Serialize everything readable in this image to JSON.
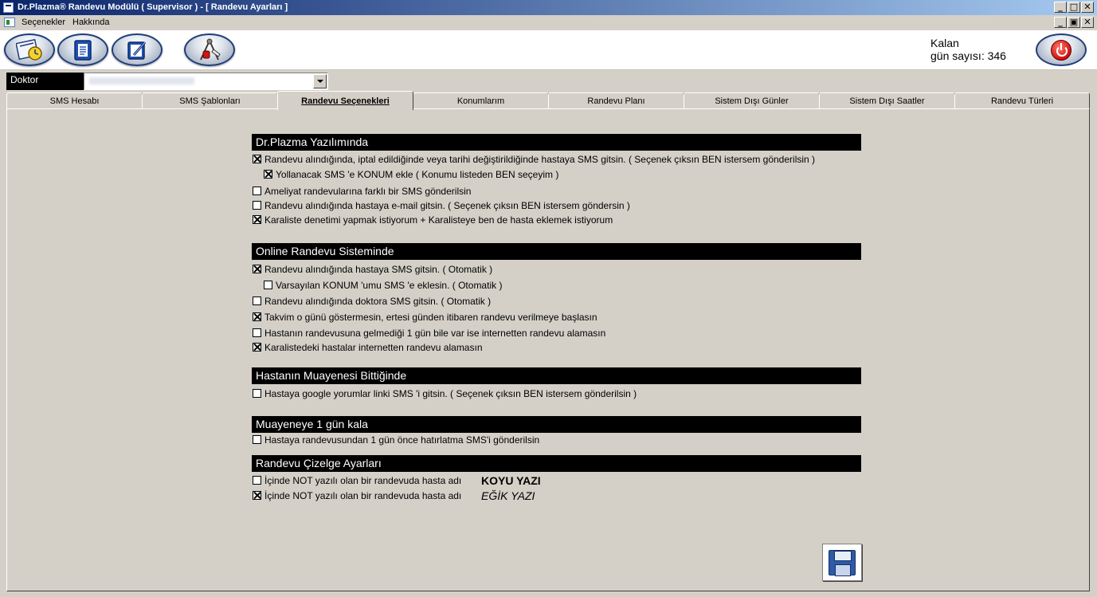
{
  "window": {
    "title": "Dr.Plazma® Randevu Modülü ( Supervisor ) - [ Randevu Ayarları ]",
    "minimize": "_",
    "maximize": "□",
    "restore": "▣",
    "close": "✕"
  },
  "menu": {
    "items": [
      "Seçenekler",
      "Hakkında"
    ]
  },
  "toolbar": {
    "buttons": [
      "calendar-clock-icon",
      "document-icon",
      "edit-icon",
      "tools-icon"
    ],
    "kalan_line1": "Kalan",
    "kalan_line2": "gün sayısı: 346",
    "power_icon": "power-icon"
  },
  "doctor": {
    "label": "Doktor"
  },
  "tabs": [
    {
      "label": "SMS Hesabı"
    },
    {
      "label": "SMS Şablonları"
    },
    {
      "label": "Randevu Seçenekleri",
      "active": true
    },
    {
      "label": "Konumlarım"
    },
    {
      "label": "Randevu Planı"
    },
    {
      "label": "Sistem Dışı Günler"
    },
    {
      "label": "Sistem Dışı Saatler"
    },
    {
      "label": "Randevu Türleri"
    }
  ],
  "sections": [
    {
      "title": "Dr.Plazma Yazılımında",
      "options": [
        {
          "label": "Randevu alındığında, iptal edildiğinde veya tarihi değiştirildiğinde hastaya SMS gitsin. ( Seçenek çıksın BEN istersem gönderilsin )",
          "checked": true
        },
        {
          "label": "Yollanacak SMS 'e  KONUM ekle ( Konumu listeden BEN seçeyim )",
          "checked": true
        },
        {
          "label": "Ameliyat randevularına farklı bir SMS gönderilsin",
          "checked": false
        },
        {
          "label": "Randevu alındığında hastaya e-mail gitsin. ( Seçenek çıksın BEN istersem göndersin )",
          "checked": false
        },
        {
          "label": "Karaliste denetimi yapmak istiyorum + Karalisteye ben de hasta eklemek istiyorum",
          "checked": true
        }
      ]
    },
    {
      "title": "Online Randevu Sisteminde",
      "options": [
        {
          "label": "Randevu alındığında hastaya SMS gitsin. ( Otomatik )",
          "checked": true
        },
        {
          "label": "Varsayılan KONUM 'umu SMS 'e eklesin. ( Otomatik )",
          "checked": false
        },
        {
          "label": "Randevu alındığında doktora SMS gitsin. ( Otomatik )",
          "checked": false
        },
        {
          "label": "Takvim o günü göstermesin, ertesi günden itibaren randevu verilmeye başlasın",
          "checked": true
        },
        {
          "label": "Hastanın randevusuna gelmediği 1 gün bile var ise internetten randevu alamasın",
          "checked": false
        },
        {
          "label": "Karalistedeki hastalar internetten randevu alamasın",
          "checked": true
        }
      ]
    },
    {
      "title": "Hastanın Muayenesi Bittiğinde",
      "options": [
        {
          "label": "Hastaya google yorumlar linki SMS 'i gitsin. ( Seçenek çıksın BEN istersem gönderilsin )",
          "checked": false
        }
      ]
    },
    {
      "title": "Muayeneye 1 gün kala",
      "options": [
        {
          "label": "Hastaya randevusundan 1 gün önce hatırlatma SMS'i gönderilsin",
          "checked": false
        }
      ]
    },
    {
      "title": "Randevu Çizelge Ayarları",
      "options": [
        {
          "label": "İçinde NOT yazılı olan bir randevuda hasta adı",
          "checked": false,
          "sample": "KOYU YAZI"
        },
        {
          "label": "İçinde NOT yazılı olan bir randevuda hasta adı",
          "checked": true,
          "sample": "EĞİK YAZI"
        }
      ]
    }
  ],
  "save": {
    "icon": "floppy-disk-icon"
  }
}
